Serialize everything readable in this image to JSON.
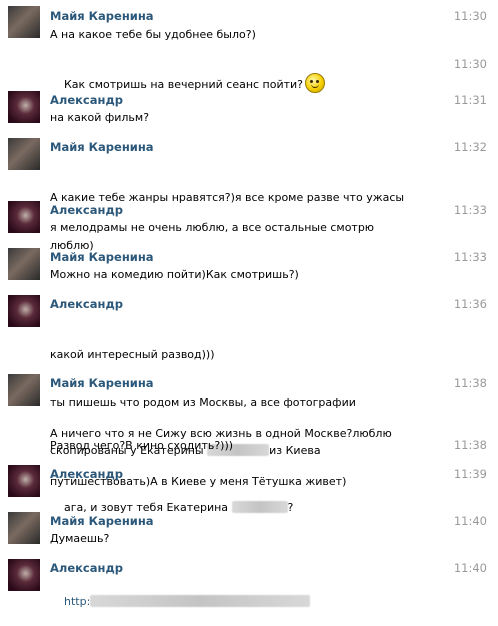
{
  "messages": [
    {
      "sender": "Майя Каренина",
      "time": "11:30",
      "text": "А на какое тебе бы удобнее было?)"
    },
    {
      "sender": "",
      "time": "11:30",
      "text": "Как смотришь на вечерний сеанс пойти?"
    },
    {
      "sender": "Александр",
      "time": "11:31",
      "text": "на какой фильм?"
    },
    {
      "sender": "Майя Каренина",
      "time": "11:32",
      "text_1": "А какие тебе жанры нравятся?)я все кроме разве что ужасы",
      "text_2": "люблю)"
    },
    {
      "sender": "Александр",
      "time": "11:33",
      "text": "я мелодрамы не очень люблю, а все остальные смотрю"
    },
    {
      "sender": "Майя Каренина",
      "time": "11:33",
      "text": "Можно на комедию пойти)Как смотришь?)"
    },
    {
      "sender": "Александр",
      "time": "11:36",
      "text_1": "какой интересный развод)))",
      "text_2": "ты пишешь что родом из Москвы, а все фотографии",
      "text_3a": "скопированы у Екатерины",
      "text_3b": "из Киева"
    },
    {
      "sender": "Майя Каренина",
      "time": "11:38",
      "text_1": "А ничего что я не Сижу всю жизнь в одной Москве?люблю",
      "text_2": "путишествовать)А в Киеве у меня Тётушка живет)"
    },
    {
      "sender": "",
      "time": "11:38",
      "text": "Развод чего?В кино сходить?)))"
    },
    {
      "sender": "Александр",
      "time": "11:39",
      "text_a": "ага, и зовут тебя Екатерина",
      "text_b": "?"
    },
    {
      "sender": "Майя Каренина",
      "time": "11:40",
      "text": "Думаешь?"
    },
    {
      "sender": "Александр",
      "time": "11:40",
      "text": "http:"
    }
  ]
}
